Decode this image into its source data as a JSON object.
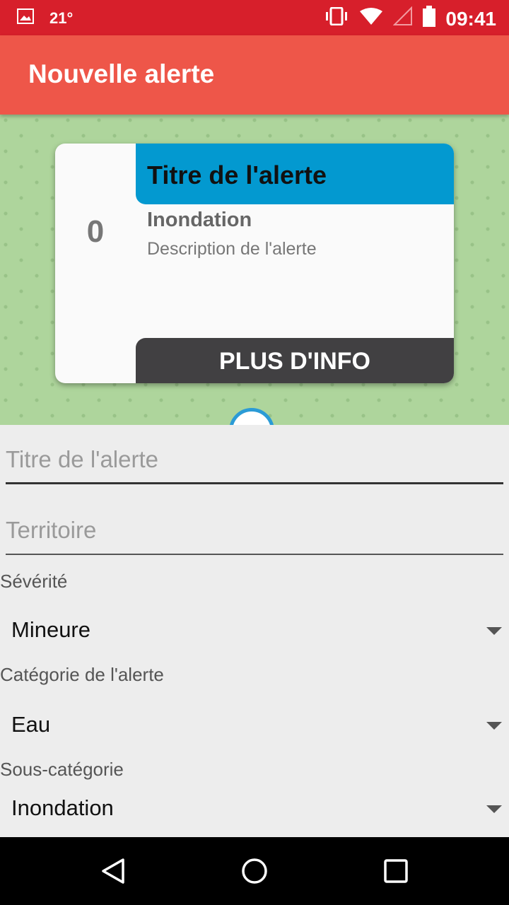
{
  "status_bar": {
    "temperature": "21°",
    "time": "09:41"
  },
  "app_bar": {
    "title": "Nouvelle alerte"
  },
  "preview_card": {
    "count": "0",
    "title": "Titre de l'alerte",
    "category": "Inondation",
    "description": "Description de l'alerte",
    "more_info_button": "PLUS D'INFO"
  },
  "form": {
    "title_placeholder": "Titre de l'alerte",
    "territory_placeholder": "Territoire",
    "severity_label": "Sévérité",
    "severity_value": "Mineure",
    "category_label": "Catégorie de l'alerte",
    "category_value": "Eau",
    "subcategory_label": "Sous-catégorie",
    "subcategory_value": "Inondation"
  }
}
